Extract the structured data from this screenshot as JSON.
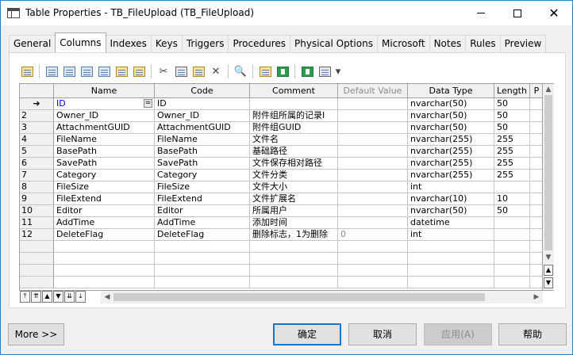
{
  "window": {
    "title": "Table Properties - TB_FileUpload (TB_FileUpload)",
    "min_icon": "minimize-icon",
    "max_icon": "maximize-icon",
    "close_glyph": "✕"
  },
  "tabs": [
    {
      "label": "General",
      "active": false
    },
    {
      "label": "Columns",
      "active": true
    },
    {
      "label": "Indexes",
      "active": false
    },
    {
      "label": "Keys",
      "active": false
    },
    {
      "label": "Triggers",
      "active": false
    },
    {
      "label": "Procedures",
      "active": false
    },
    {
      "label": "Physical Options",
      "active": false
    },
    {
      "label": "Microsoft",
      "active": false
    },
    {
      "label": "Notes",
      "active": false
    },
    {
      "label": "Rules",
      "active": false
    },
    {
      "label": "Preview",
      "active": false
    }
  ],
  "toolbar": {
    "delete_glyph": "✕",
    "find_glyph": "🔍",
    "dropdown_glyph": "▾"
  },
  "grid": {
    "headers": [
      "Name",
      "Code",
      "Comment",
      "Default Value",
      "Data Type",
      "Length",
      "P"
    ],
    "selected_row_marker": "➜",
    "eq_button_label": "=",
    "rows": [
      {
        "num": "",
        "name": "ID",
        "code": "ID",
        "comment": "",
        "default": "",
        "type": "nvarchar(50)",
        "length": "50"
      },
      {
        "num": "2",
        "name": "Owner_ID",
        "code": "Owner_ID",
        "comment": "附件组所属的记录I",
        "default": "",
        "type": "nvarchar(50)",
        "length": "50"
      },
      {
        "num": "3",
        "name": "AttachmentGUID",
        "code": "AttachmentGUID",
        "comment": "附件组GUID",
        "default": "",
        "type": "nvarchar(50)",
        "length": "50"
      },
      {
        "num": "4",
        "name": "FileName",
        "code": "FileName",
        "comment": "文件名",
        "default": "",
        "type": "nvarchar(255)",
        "length": "255"
      },
      {
        "num": "5",
        "name": "BasePath",
        "code": "BasePath",
        "comment": "基础路径",
        "default": "",
        "type": "nvarchar(255)",
        "length": "255"
      },
      {
        "num": "6",
        "name": "SavePath",
        "code": "SavePath",
        "comment": "文件保存相对路径",
        "default": "",
        "type": "nvarchar(255)",
        "length": "255"
      },
      {
        "num": "7",
        "name": "Category",
        "code": "Category",
        "comment": "文件分类",
        "default": "",
        "type": "nvarchar(255)",
        "length": "255"
      },
      {
        "num": "8",
        "name": "FileSize",
        "code": "FileSize",
        "comment": "文件大小",
        "default": "",
        "type": "int",
        "length": ""
      },
      {
        "num": "9",
        "name": "FileExtend",
        "code": "FileExtend",
        "comment": "文件扩展名",
        "default": "",
        "type": "nvarchar(10)",
        "length": "10"
      },
      {
        "num": "10",
        "name": "Editor",
        "code": "Editor",
        "comment": "所属用户",
        "default": "",
        "type": "nvarchar(50)",
        "length": "50"
      },
      {
        "num": "11",
        "name": "AddTime",
        "code": "AddTime",
        "comment": "添加时间",
        "default": "",
        "type": "datetime",
        "length": ""
      },
      {
        "num": "12",
        "name": "DeleteFlag",
        "code": "DeleteFlag",
        "comment": "删除标志，1为删除",
        "default": "0",
        "type": "int",
        "length": ""
      },
      {
        "num": "",
        "name": "",
        "code": "",
        "comment": "",
        "default": "",
        "type": "",
        "length": ""
      },
      {
        "num": "",
        "name": "",
        "code": "",
        "comment": "",
        "default": "",
        "type": "",
        "length": ""
      },
      {
        "num": "",
        "name": "",
        "code": "",
        "comment": "",
        "default": "",
        "type": "",
        "length": ""
      },
      {
        "num": "",
        "name": "",
        "code": "",
        "comment": "",
        "default": "",
        "type": "",
        "length": ""
      }
    ]
  },
  "scroll": {
    "up": "▲",
    "down": "▼",
    "left": "◀",
    "right": "▶"
  },
  "nav": [
    "⤒",
    "⇈",
    "▲",
    "▼",
    "⇊",
    "⤓"
  ],
  "buttons": {
    "more": "More >>",
    "ok": "确定",
    "cancel": "取消",
    "apply": "应用(A)",
    "help": "帮助"
  }
}
